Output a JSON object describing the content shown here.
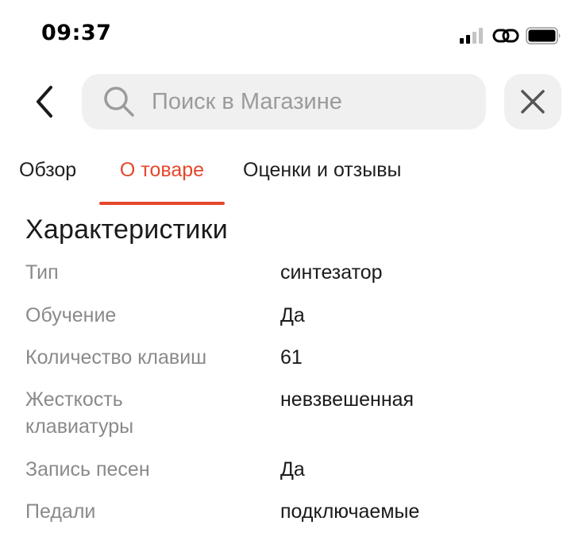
{
  "status_bar": {
    "time": "09:37",
    "icons": [
      "signal-icon",
      "link-icon",
      "battery-icon"
    ]
  },
  "header": {
    "back_icon": "chevron-left-icon",
    "search": {
      "placeholder": "Поиск в Магазине",
      "value": "",
      "icon": "search-icon"
    },
    "close_icon": "close-icon"
  },
  "tabs": [
    {
      "label": "Обзор",
      "active": false
    },
    {
      "label": "О товаре",
      "active": true
    },
    {
      "label": "Оценки и отзывы",
      "active": false
    }
  ],
  "characteristics": {
    "title": "Характеристики",
    "rows": [
      {
        "label": "Тип",
        "value": "синтезатор"
      },
      {
        "label": "Обучение",
        "value": "Да"
      },
      {
        "label": "Количество клавиш",
        "value": "61"
      },
      {
        "label": "Жесткость клавиатуры",
        "value": "невзвешенная"
      },
      {
        "label": "Запись песен",
        "value": "Да"
      },
      {
        "label": "Педали",
        "value": "подключаемые"
      }
    ]
  },
  "colors": {
    "accent": "#e5472b",
    "label_gray": "#8a8a8a",
    "search_bg": "#f0f0f0"
  }
}
